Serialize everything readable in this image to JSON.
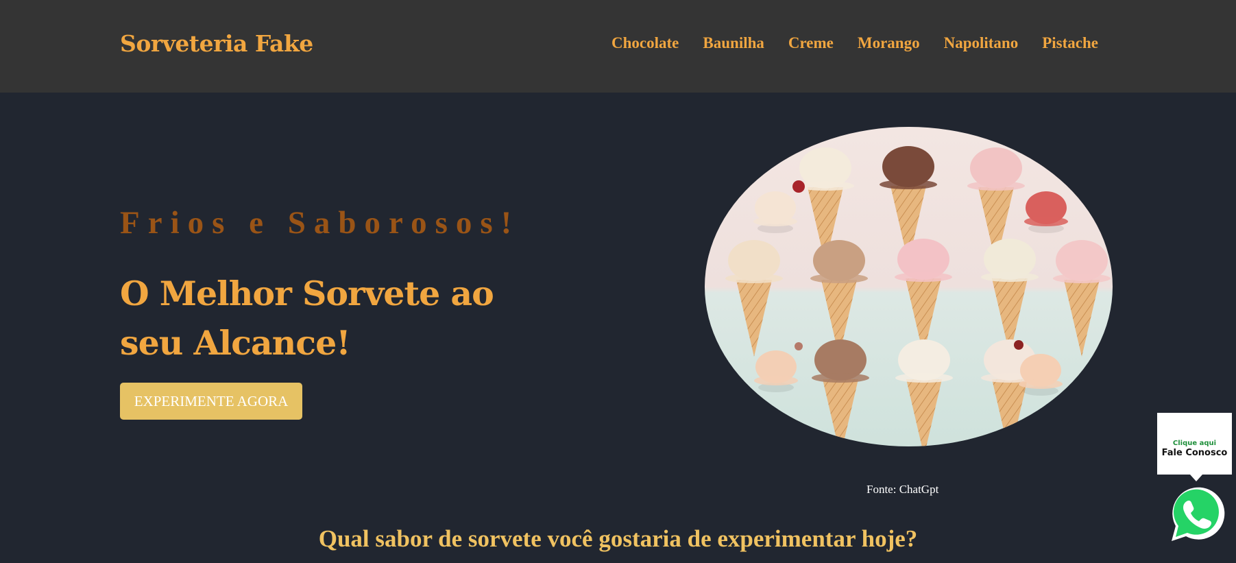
{
  "header": {
    "brand": "Sorveteria Fake",
    "nav": [
      {
        "label": "Chocolate"
      },
      {
        "label": "Baunilha"
      },
      {
        "label": "Creme"
      },
      {
        "label": "Morango"
      },
      {
        "label": "Napolitano"
      },
      {
        "label": "Pistache"
      }
    ]
  },
  "hero": {
    "eyebrow": "Frios e Saborosos!",
    "headline": "O Melhor Sorvete ao seu Alcance!",
    "cta_label": "EXPERIMENTE AGORA",
    "image_caption": "Fonte: ChatGpt"
  },
  "section": {
    "question": "Qual sabor de sorvete você gostaria de experimentar hoje?"
  },
  "chat_widget": {
    "line1": "Clique aqui",
    "line2": "Fale Conosco",
    "icon": "whatsapp-icon"
  },
  "colors": {
    "background": "#212630",
    "navbar": "#343434",
    "accent": "#f1a640",
    "eyebrow": "#9a5416",
    "button": "#e6c264",
    "whatsapp": "#25d366"
  }
}
